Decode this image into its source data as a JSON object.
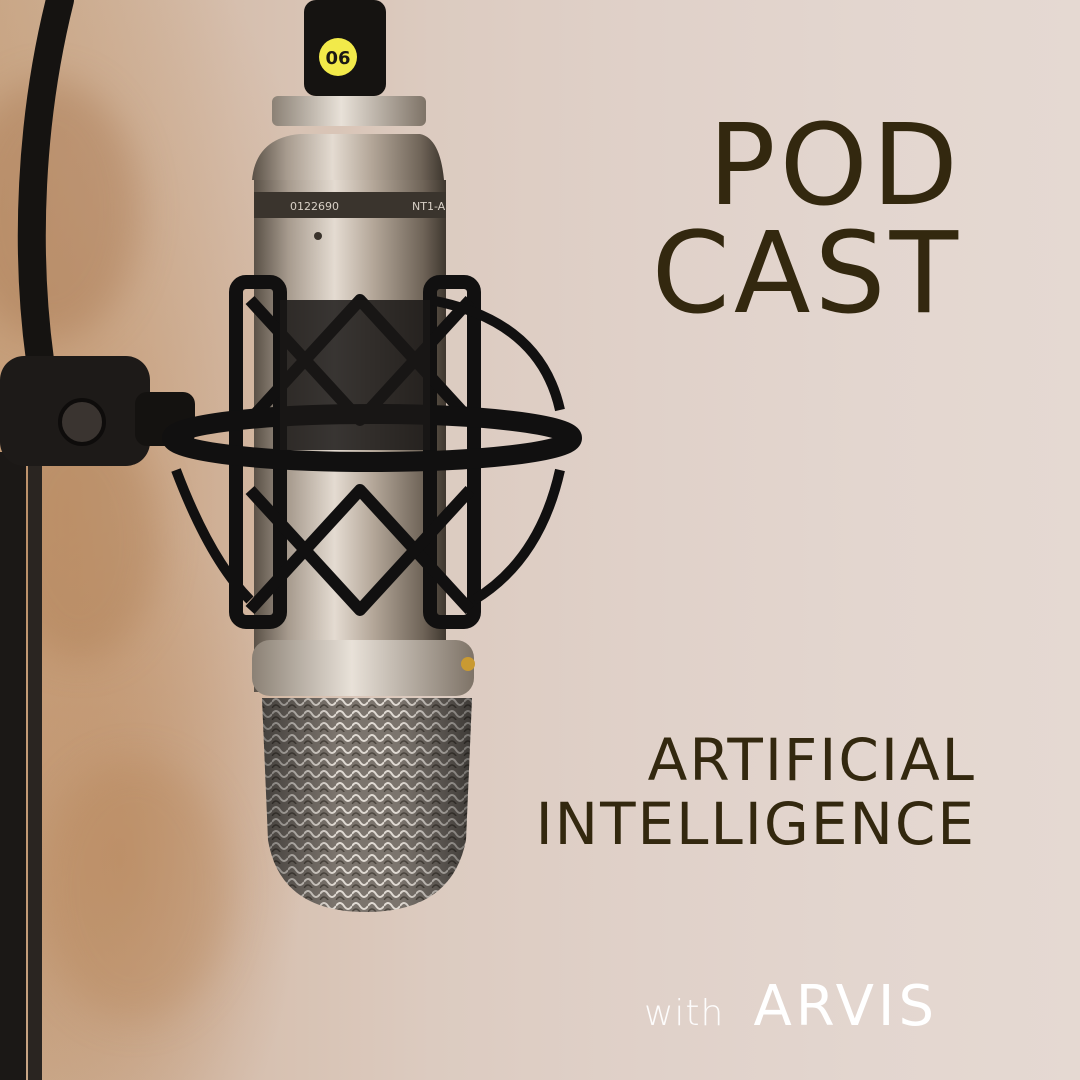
{
  "title": {
    "line1": "POD",
    "line2": "CAST"
  },
  "subtitle": {
    "line1": "ARTIFICIAL",
    "line2": "INTELLIGENCE"
  },
  "byline": {
    "prefix": "with",
    "name": "ARVIS"
  },
  "microphone": {
    "label_number": "06",
    "serial": "0122690",
    "model": "NT1-A"
  },
  "colors": {
    "text_dark": "#33280f",
    "text_light": "#ffffff",
    "background": "#e0d1c9",
    "accent_label": "#f2ea4a"
  },
  "icons": [
    "microphone-icon",
    "shock-mount-icon",
    "mic-stand-icon"
  ]
}
